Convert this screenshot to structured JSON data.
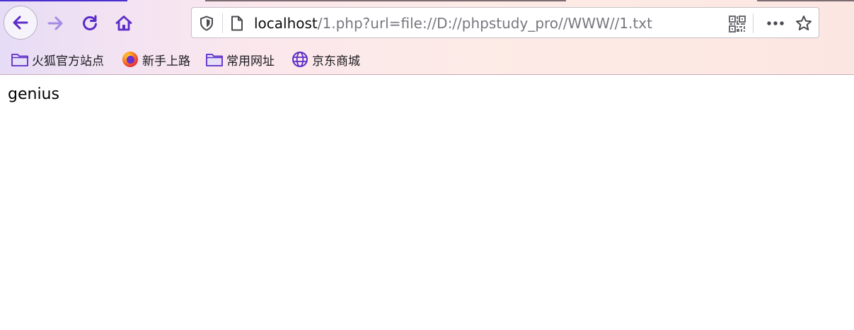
{
  "toolbar": {
    "back_icon": "back-arrow-icon",
    "forward_icon": "forward-arrow-icon",
    "reload_icon": "reload-icon",
    "home_icon": "home-icon"
  },
  "urlbar": {
    "host": "localhost",
    "path": "/1.php?url=file://D://phpstudy_pro//WWW//1.txt",
    "shield_icon": "tracking-protection-shield-icon",
    "page_icon": "page-info-icon",
    "qr_icon": "qr-code-icon",
    "more_icon": "page-actions-more-icon",
    "star_icon": "bookmark-star-icon"
  },
  "bookmarks": {
    "items": [
      {
        "label": "火狐官方站点",
        "icon": "folder-icon"
      },
      {
        "label": "新手上路",
        "icon": "firefox-logo-icon"
      },
      {
        "label": "常用网址",
        "icon": "folder-icon"
      },
      {
        "label": "京东商城",
        "icon": "globe-icon"
      }
    ]
  },
  "page": {
    "body_text": "genius"
  },
  "colors": {
    "accent": "#5b2bc8",
    "forward_disabled": "#a58be3",
    "text": "#000000",
    "url_path": "#77777f"
  }
}
